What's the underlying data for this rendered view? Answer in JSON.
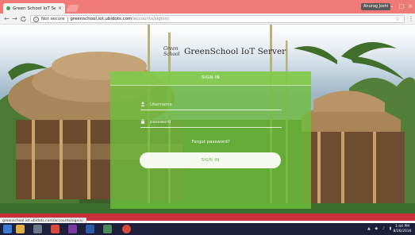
{
  "browser": {
    "tab_title": "Green School IoT Server",
    "tab_close": "×",
    "user_name": "Anurag Joshi",
    "security_label": "Not secure",
    "url_host": "greenschool.iot.ubidots.com",
    "url_path": "/accounts/signin/",
    "status_url": "greenschool.iot.ubidots.com/accounts/signin/",
    "nav": {
      "back": "←",
      "forward": "→",
      "reload": "C"
    },
    "window_controls": {
      "minimize": "–",
      "maximize": "□",
      "close": "×"
    }
  },
  "brand": {
    "logo_text": "Green School",
    "name": "GreenSchool IoT Server"
  },
  "login": {
    "header": "SIGN IN",
    "username_placeholder": "Username",
    "password_placeholder": "password",
    "forgot_link": "Forgot password?",
    "signin_button": "SIGN IN"
  },
  "taskbar": {
    "time": "1:44 PM",
    "date": "8/26/2016"
  },
  "colors": {
    "chrome_bar": "#f07a78",
    "panel_green": "#6ebe3c",
    "taskbar": "#1e1f3a"
  }
}
